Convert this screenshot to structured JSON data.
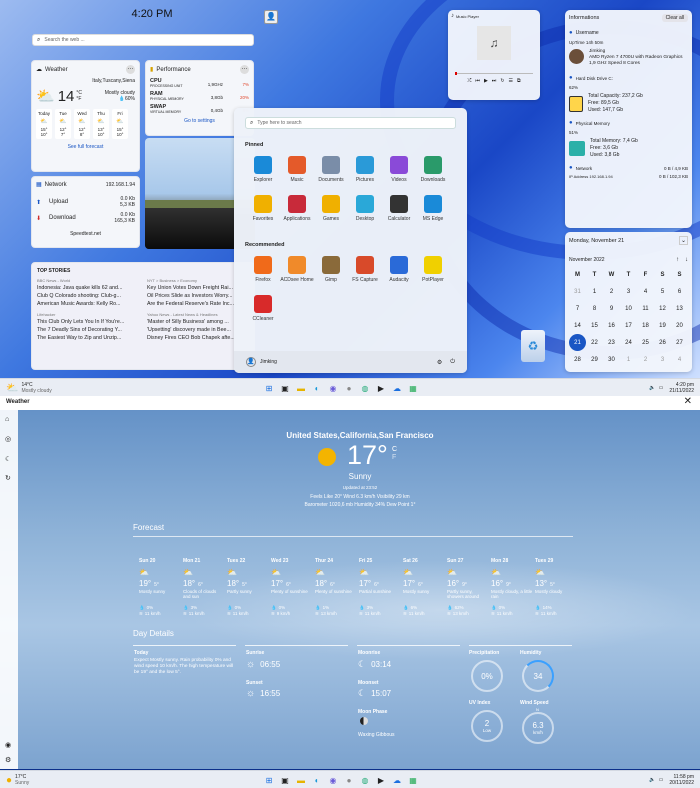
{
  "desktop": {
    "clock": {
      "time": "4:20 PM",
      "search_placeholder": "Search the web ..."
    },
    "weather_widget": {
      "title": "Weather",
      "location": "Italy,Tuscany,Siena",
      "temp": "14",
      "unit_c": "°C",
      "unit_f": "°F",
      "desc": "Mostly cloudy",
      "humidity": "60%",
      "days": [
        {
          "d": "Today",
          "hi": "15°",
          "lo": "10°"
        },
        {
          "d": "Tue",
          "hi": "12°",
          "lo": "7°"
        },
        {
          "d": "Wed",
          "hi": "12°",
          "lo": "8°"
        },
        {
          "d": "Thu",
          "hi": "13°",
          "lo": "10°"
        },
        {
          "d": "Fri",
          "hi": "15°",
          "lo": "10°"
        }
      ],
      "link": "See full forecast"
    },
    "performance": {
      "title": "Performance",
      "items": [
        {
          "name": "CPU",
          "sub": "PROCESSING UNIT",
          "val": "1,9GHz",
          "pct": "7%"
        },
        {
          "name": "RAM",
          "sub": "PHYSICAL MEMORY",
          "val": "3,8Gb",
          "pct": "20%"
        },
        {
          "name": "SWAP",
          "sub": "VIRTUAL MEMORY",
          "val": "0,4Gb",
          "pct": "8%"
        }
      ],
      "link": "Go to settings"
    },
    "network": {
      "title": "Network",
      "ip": "192.168.1.94",
      "upload": "Upload",
      "up_rate": "0.0 Kb",
      "up_total": "5,3 KB",
      "download": "Download",
      "down_rate": "0.0 Kb",
      "down_total": "165,3 KB",
      "link": "Speedtest.net"
    },
    "news": {
      "title": "TOP STORIES",
      "col1": [
        {
          "src": "BBC News - World",
          "h": "Indonesia: Java quake kills 62 and..."
        },
        {
          "h": "Club Q Colorado shooting: Club-g..."
        },
        {
          "h": "American Music Awards: Kelly Ro..."
        },
        {
          "src": "Lifehacker",
          "h": "This Club Only Lets You In If You're..."
        },
        {
          "h": "The 7 Deadly Sins of Decorating Y..."
        },
        {
          "h": "The Easiest Way to Zip and Unzip..."
        }
      ],
      "col2": [
        {
          "src": "NYT > Business > Economy",
          "h": "Key Union Votes Down Freight Rai..."
        },
        {
          "h": "Oil Prices Slide as Investors Worry..."
        },
        {
          "h": "Are the Federal Reserve's Rate Inc..."
        },
        {
          "src": "Yahoo News - Latest News & Headlines",
          "h": "'Master of Silly Business' among ..."
        },
        {
          "h": "'Upsetting' discovery made in Bee..."
        },
        {
          "h": "Disney Fires CEO Bob Chapek afte..."
        }
      ]
    },
    "music": {
      "title": "Music Player"
    },
    "info": {
      "title": "Informations",
      "clear": "Clear all",
      "username_label": "Username",
      "uptime": "UpTime 14h 50m",
      "user": "Jimking",
      "cpu": "AMD Ryzen 7 4700U with Radeon Graphics",
      "cpu_speed": "1,9 GHz Speed 8 Cores",
      "disk_label": "Hard Disk Drive C:",
      "disk_pct": "62%",
      "disk_total": "Total Capacity: 237,2 Gb",
      "disk_free": "Free: 89,5 Gb",
      "disk_used": "Used: 147,7 Gb",
      "mem_label": "Physical Memory",
      "mem_pct": "51%",
      "mem_total": "Total Memory: 7,4 Gb",
      "mem_free": "Free: 3,6 Gb",
      "mem_used": "Used: 3,8 Gb",
      "net_label": "Network",
      "net_ip": "IP Address 192.168.1.94",
      "net_v1": "0 B / 4,9 KB",
      "net_v2": "0 B / 102,3 KB"
    },
    "calendar": {
      "header": "Monday, November 21",
      "month": "November 2022",
      "dow": [
        "M",
        "T",
        "W",
        "T",
        "F",
        "S",
        "S"
      ],
      "weeks": [
        [
          "31",
          "1",
          "2",
          "3",
          "4",
          "5",
          "6"
        ],
        [
          "7",
          "8",
          "9",
          "10",
          "11",
          "12",
          "13"
        ],
        [
          "14",
          "15",
          "16",
          "17",
          "18",
          "19",
          "20"
        ],
        [
          "21",
          "22",
          "23",
          "24",
          "25",
          "26",
          "27"
        ],
        [
          "28",
          "29",
          "30",
          "1",
          "2",
          "3",
          "4"
        ]
      ],
      "today": "21"
    },
    "start": {
      "search_placeholder": "Type here to search",
      "pinned_label": "Pinned",
      "pinned": [
        "Explorer",
        "Music",
        "Documents",
        "Pictures",
        "Videos",
        "Downloads",
        "Favorites",
        "Applications",
        "Games",
        "Desktop",
        "Calculator",
        "MS Edge"
      ],
      "recommended_label": "Recommended",
      "recommended": [
        "Firefox",
        "ACDsee Home",
        "Gimp",
        "FS Capture",
        "Audacity",
        "PotPlayer",
        "CCleaner"
      ],
      "user": "Jimking"
    },
    "taskbar": {
      "temp": "14°C",
      "desc": "Mostly cloudy",
      "time": "4:20 pm",
      "date": "21/11/2022"
    }
  },
  "weather_app": {
    "title": "Weather",
    "city": "United States,California,San Francisco",
    "temp": "17°",
    "unit_c": "C",
    "unit_f": "F",
    "desc": "Sunny",
    "updated": "Updated at 23:52",
    "details_line1": "Feels Like  20°    Wind  6.3 km/h    Visibility  29 km",
    "details_line2": "Barometer  1020,6 mb    Humidity  34%    Dew Point  1°",
    "forecast_label": "Forecast",
    "forecast": [
      {
        "d": "Sun 20",
        "hi": "19°",
        "lo": "5°",
        "desc": "Mostly sunny",
        "p": "0%",
        "w": "11 km/h"
      },
      {
        "d": "Mon 21",
        "hi": "18°",
        "lo": "6°",
        "desc": "Clouds of clouds and sun",
        "p": "3%",
        "w": "11 km/h"
      },
      {
        "d": "Tues 22",
        "hi": "18°",
        "lo": "5°",
        "desc": "Partly sunny",
        "p": "0%",
        "w": "11 km/h"
      },
      {
        "d": "Wed 23",
        "hi": "17°",
        "lo": "6°",
        "desc": "Plenty of sunshine",
        "p": "0%",
        "w": "9 km/h"
      },
      {
        "d": "Thur 24",
        "hi": "18°",
        "lo": "6°",
        "desc": "Plenty of sunshine",
        "p": "1%",
        "w": "13 km/h"
      },
      {
        "d": "Fri 25",
        "hi": "17°",
        "lo": "6°",
        "desc": "Partial sunshine",
        "p": "3%",
        "w": "11 km/h"
      },
      {
        "d": "Sat 26",
        "hi": "17°",
        "lo": "6°",
        "desc": "Mostly sunny",
        "p": "6%",
        "w": "11 km/h"
      },
      {
        "d": "Sun 27",
        "hi": "16°",
        "lo": "9°",
        "desc": "Partly sunny, showers around",
        "p": "62%",
        "w": "13 km/h"
      },
      {
        "d": "Mon 28",
        "hi": "16°",
        "lo": "9°",
        "desc": "Mostly cloudy, a little rain",
        "p": "0%",
        "w": "11 km/h"
      },
      {
        "d": "Tues 29",
        "hi": "13°",
        "lo": "5°",
        "desc": "Mostly cloudy",
        "p": "14%",
        "w": "11 km/h"
      }
    ],
    "day_details_label": "Day Details",
    "today_label": "Today",
    "today_text": "Expect Mostly sunny. Rain probability 0% and wind speed 10 km/h. The high temperature will be 19° and the low 5°.",
    "sunrise_label": "Sunrise",
    "sunrise": "06:55",
    "sunset_label": "Sunset",
    "sunset": "16:55",
    "moonrise_label": "Moonrise",
    "moonrise": "03:14",
    "moonset_label": "Moonset",
    "moonset": "15:07",
    "moonphase_label": "Moon Phase",
    "moonphase": "Waxing Gibbous",
    "precip_label": "Precipitation",
    "precip": "0%",
    "humidity_label": "Humidity",
    "humidity": "34",
    "uv_label": "UV Index",
    "uv": "2",
    "uv_desc": "Low",
    "wind_label": "Wind Speed",
    "wind": "6.3",
    "wind_unit": "km/h",
    "wind_n": "N",
    "taskbar": {
      "temp": "17°C",
      "desc": "Sunny",
      "time": "11:58 pm",
      "date": "20/11/2022"
    }
  }
}
